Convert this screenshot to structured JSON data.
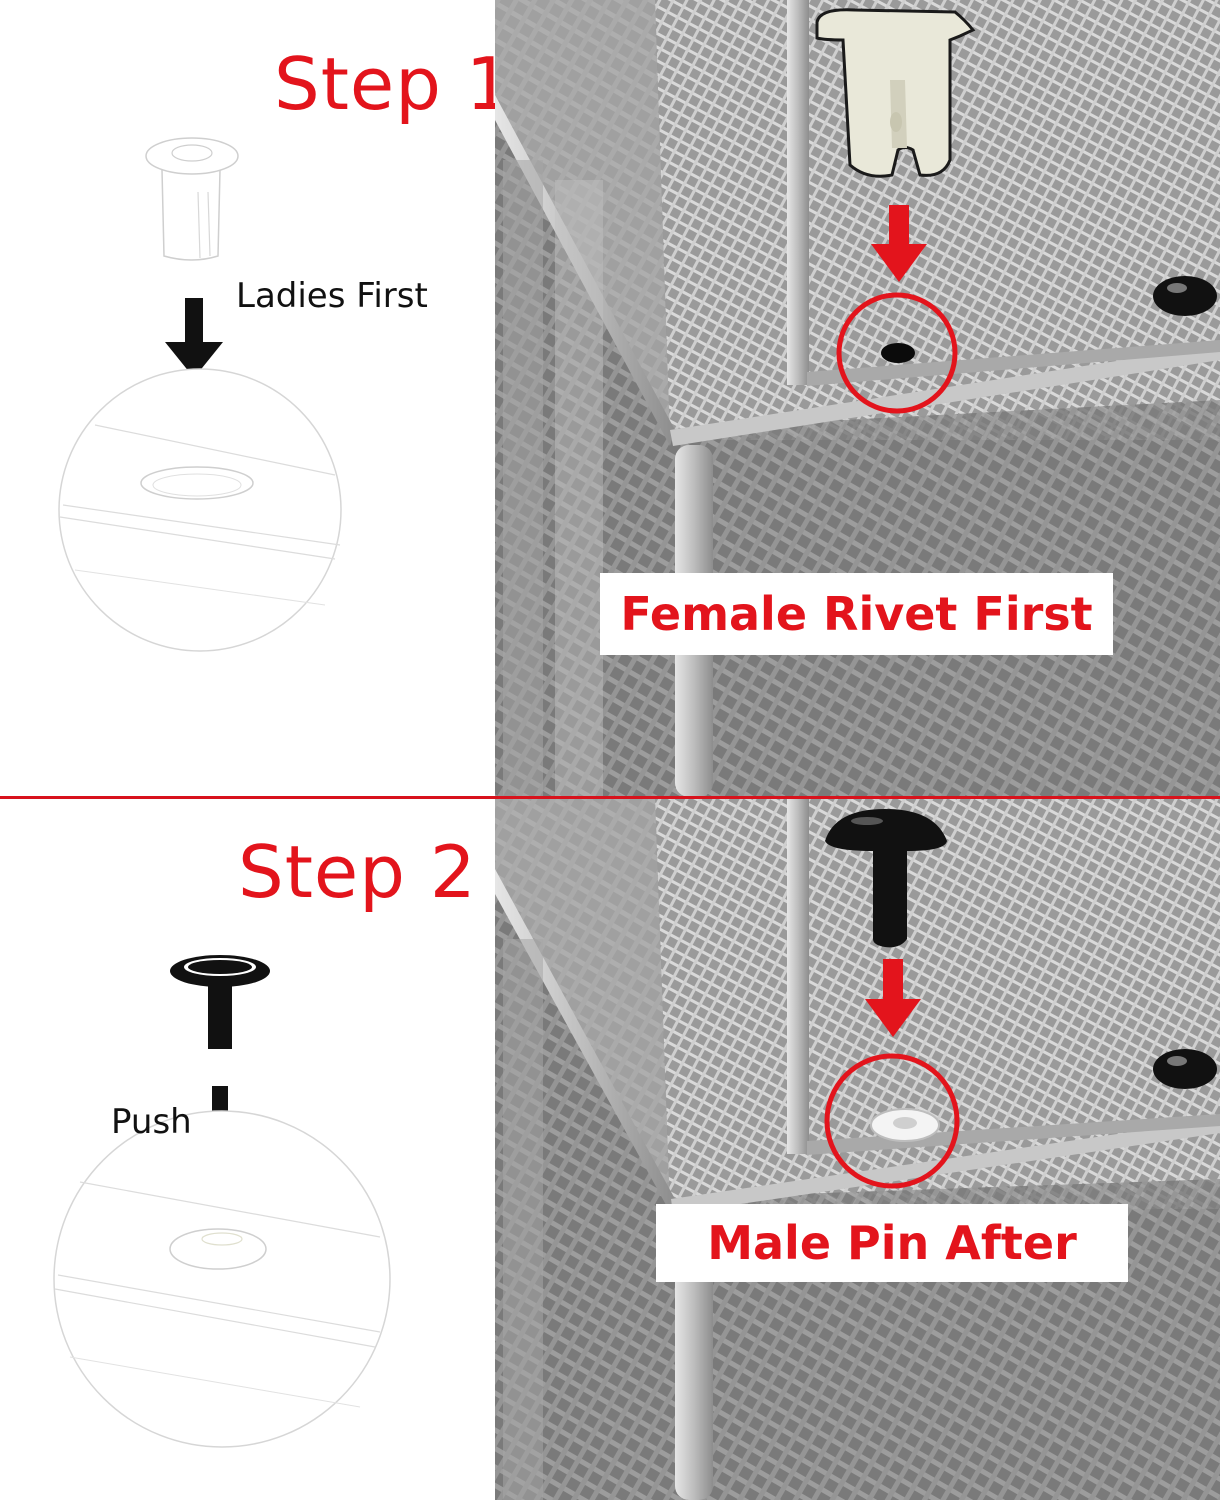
{
  "steps": [
    {
      "title": "Step 1",
      "hint": "Ladies First",
      "callout": "Female Rivet First"
    },
    {
      "title": "Step 2",
      "hint": "Push",
      "callout": "Male Pin After"
    }
  ],
  "colors": {
    "accent": "#e3141c",
    "divider": "#d8121c",
    "mesh": "#8c8c8c",
    "female_rivet": "#e9e8d9",
    "male_pin": "#111111"
  }
}
